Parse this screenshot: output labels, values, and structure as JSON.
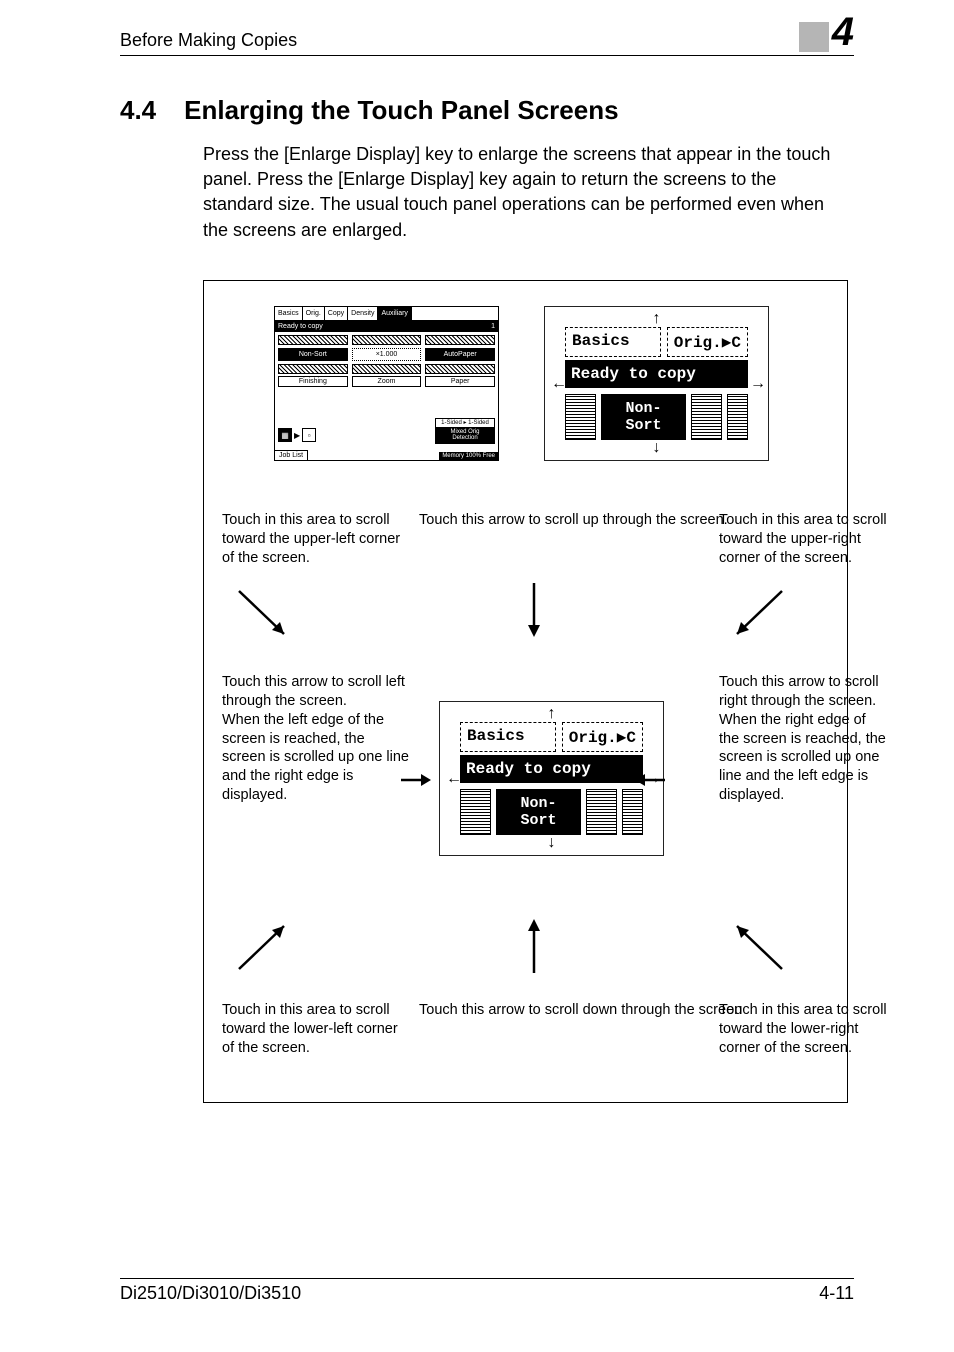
{
  "header": {
    "left": "Before Making Copies",
    "chapter_number": "4"
  },
  "section": {
    "number": "4.4",
    "title": "Enlarging the Touch Panel Screens"
  },
  "body_paragraph": "Press the [Enlarge Display] key to enlarge the screens that appear in the touch panel. Press the [Enlarge Display] key again to return the screens to the standard size. The usual touch panel operations can be performed even when the screens are enlarged.",
  "full_screen": {
    "tabs": [
      "Basics",
      "Orig.",
      "Copy",
      "Density",
      "Auxiliary"
    ],
    "ready": "Ready to copy",
    "count": "1",
    "row1": [
      "Non-Sort",
      "×1.000",
      "AutoPaper"
    ],
    "row2_labels": [
      "Finishing",
      "Zoom",
      "Paper"
    ],
    "sided": "1-Sided ▸\n1-Sided",
    "mixed": "Mixed Orig\nDetection",
    "joblist": "Job List",
    "memfree": "Memory 100%\nFree"
  },
  "enlarged": {
    "tab1": "Basics",
    "tab2": "Orig.▶C",
    "ready": "Ready to copy",
    "btn": "Non-Sort"
  },
  "captions": {
    "ul": "Touch in this area to scroll toward the upper-left corner of the screen.",
    "up": "Touch this arrow to scroll up through the screen.",
    "ur": "Touch in this area to scroll toward the upper-right corner of the screen.",
    "left": "Touch this arrow to scroll left through the screen.\nWhen the left edge of the screen is reached, the screen is scrolled up one line and the right edge is displayed.",
    "right": "Touch this arrow to scroll right through the screen.\nWhen the right edge of the screen is reached, the screen is scrolled up one line and the left edge is displayed.",
    "ll": "Touch in this area to scroll toward the lower-left corner of the screen.",
    "down": "Touch this arrow to scroll down through the screen",
    "lr": "Touch in this area to scroll toward the lower-right corner of the screen."
  },
  "footer": {
    "left": "Di2510/Di3010/Di3510",
    "right": "4-11"
  }
}
